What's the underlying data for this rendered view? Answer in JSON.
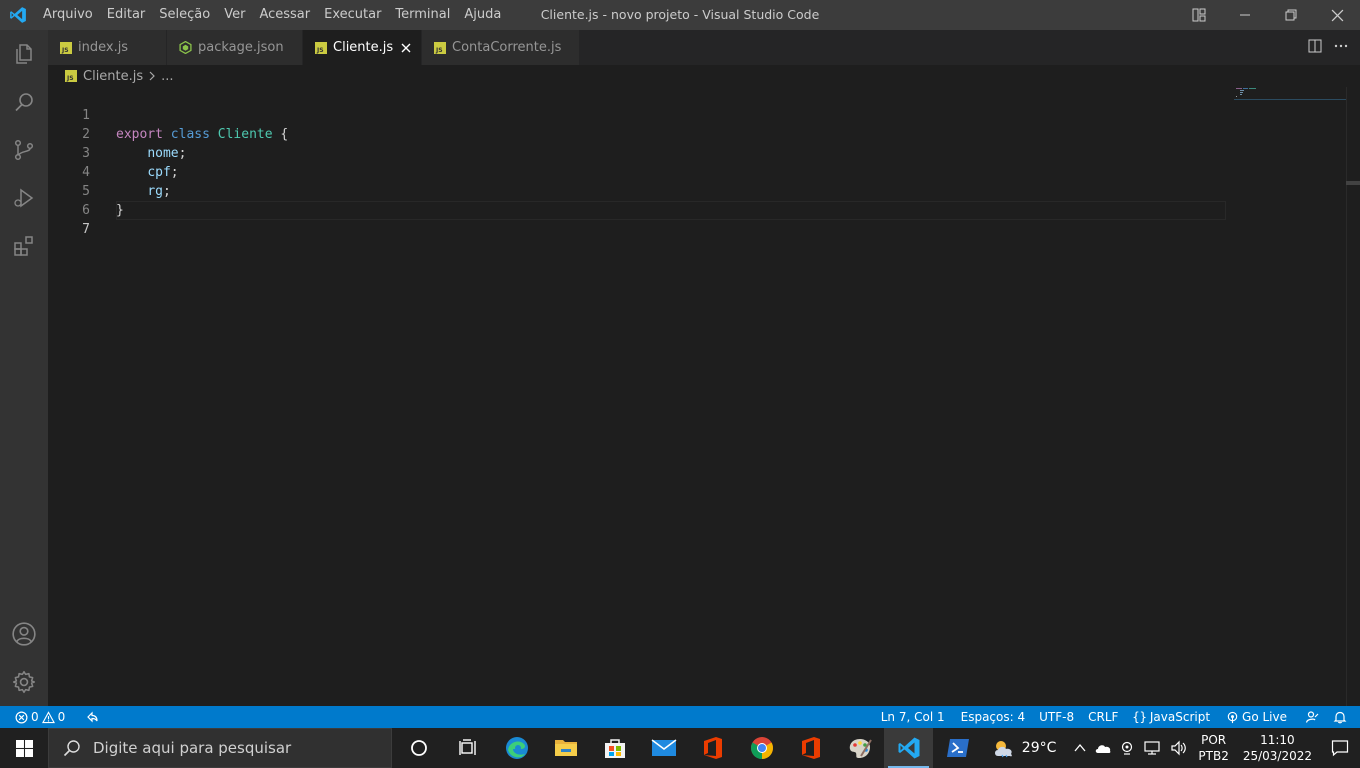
{
  "window": {
    "title": "Cliente.js - novo projeto - Visual Studio Code"
  },
  "menu": [
    "Arquivo",
    "Editar",
    "Seleção",
    "Ver",
    "Acessar",
    "Executar",
    "Terminal",
    "Ajuda"
  ],
  "tabs": [
    {
      "label": "index.js",
      "icon": "js-file-icon"
    },
    {
      "label": "package.json",
      "icon": "npm-package-icon"
    },
    {
      "label": "Cliente.js",
      "icon": "js-file-icon",
      "active": true
    },
    {
      "label": "ContaCorrente.js",
      "icon": "js-file-icon"
    }
  ],
  "breadcrumb": {
    "file": "Cliente.js",
    "rest": "..."
  },
  "editor": {
    "line_numbers": [
      "1",
      "2",
      "3",
      "4",
      "5",
      "6",
      "7"
    ],
    "lines": {
      "l1_kw1": "export",
      "l1_kw2": "class",
      "l1_cls": "Cliente",
      "l1_brace": "{",
      "l2_prop": "nome",
      "l3_prop": "cpf",
      "l4_prop": "rg",
      "semicolon": ";",
      "l5_brace": "}"
    }
  },
  "statusbar": {
    "errors": "0",
    "warnings": "0",
    "position": "Ln 7, Col 1",
    "spaces": "Espaços: 4",
    "encoding": "UTF-8",
    "eol": "CRLF",
    "language": "JavaScript",
    "golive": "Go Live"
  },
  "taskbar": {
    "search_placeholder": "Digite aqui para pesquisar",
    "temperature": "29°C",
    "lang_top": "POR",
    "lang_bottom": "PTB2",
    "time": "11:10",
    "date": "25/03/2022"
  },
  "colors": {
    "accent": "#007acc",
    "keyword": "#569cd6",
    "keyword_control": "#c586c0",
    "class_name": "#4ec9b0",
    "property": "#9cdcfe"
  }
}
